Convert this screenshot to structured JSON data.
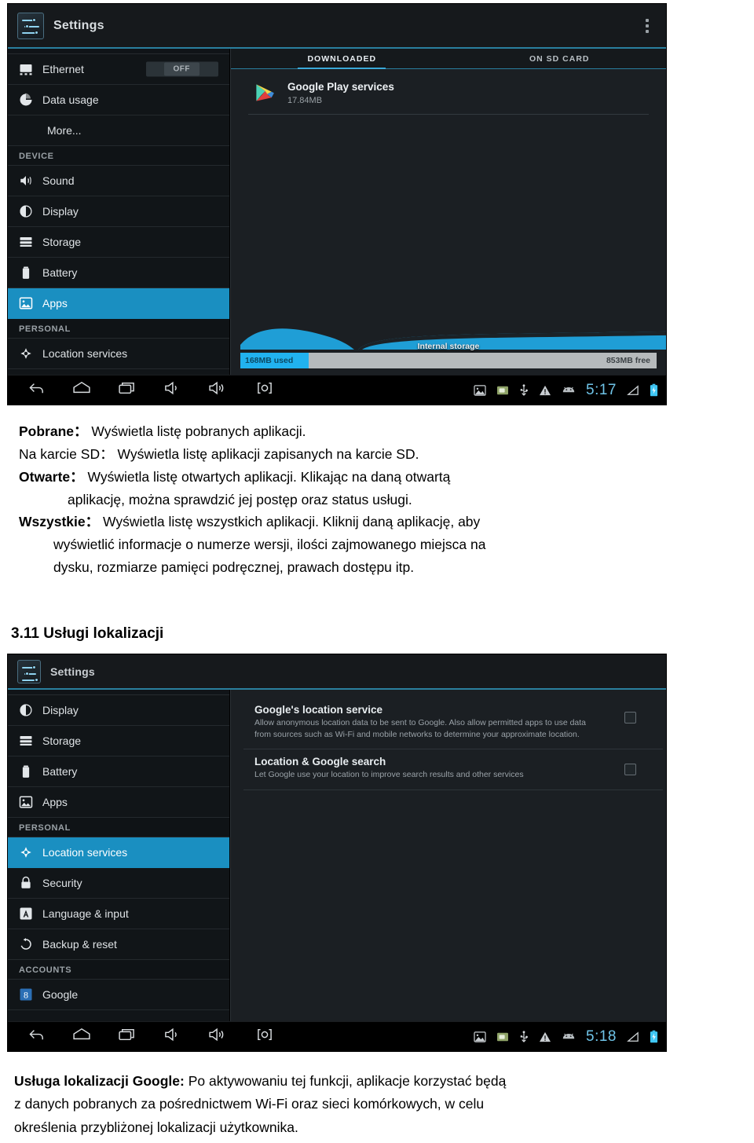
{
  "screenshot_apps": {
    "actionbar": {
      "title": "Settings",
      "overflow_icon": "overflow-menu-icon"
    },
    "sidebar": {
      "rows": [
        {
          "label": "Ethernet",
          "icon": "ethernet-icon",
          "toggle": "OFF",
          "selected": false,
          "indent": false
        },
        {
          "label": "Data usage",
          "icon": "data-usage-icon",
          "selected": false,
          "indent": false
        },
        {
          "label": "More...",
          "icon": "none",
          "selected": false,
          "indent": true
        },
        {
          "label": "DEVICE",
          "type": "header"
        },
        {
          "label": "Sound",
          "icon": "sound-icon",
          "selected": false,
          "indent": false
        },
        {
          "label": "Display",
          "icon": "display-icon",
          "selected": false,
          "indent": false
        },
        {
          "label": "Storage",
          "icon": "storage-icon",
          "selected": false,
          "indent": false
        },
        {
          "label": "Battery",
          "icon": "battery-icon",
          "selected": false,
          "indent": false
        },
        {
          "label": "Apps",
          "icon": "apps-icon",
          "selected": true,
          "indent": false
        },
        {
          "label": "PERSONAL",
          "type": "header"
        },
        {
          "label": "Location services",
          "icon": "location-icon",
          "selected": false,
          "indent": false
        }
      ]
    },
    "tabs": [
      {
        "label": "DOWNLOADED",
        "active": true
      },
      {
        "label": "ON SD CARD",
        "active": false
      }
    ],
    "apps": [
      {
        "name": "Google Play services",
        "size": "17.84MB",
        "icon": "play-services-icon"
      }
    ],
    "storage": {
      "label": "Internal storage",
      "used": "168MB used",
      "free": "853MB free",
      "used_percent": 16.5,
      "used_color": "#21b2ef",
      "free_color": "#b6babc"
    },
    "navbar": {
      "left_icons": [
        "back-icon",
        "home-icon",
        "recents-icon",
        "volume-down-icon",
        "volume-up-icon",
        "screenshot-icon"
      ],
      "status_icons": [
        "image-icon",
        "sd-card-icon",
        "usb-icon",
        "warning-icon",
        "android-icon"
      ],
      "clock": "5:17",
      "right_icons": [
        "signal-icon",
        "battery-charging-icon"
      ]
    }
  },
  "screenshot_location": {
    "actionbar": {
      "title": "Settings"
    },
    "sidebar": {
      "rows": [
        {
          "label": "Display",
          "icon": "display-icon",
          "selected": false
        },
        {
          "label": "Storage",
          "icon": "storage-icon",
          "selected": false
        },
        {
          "label": "Battery",
          "icon": "battery-icon",
          "selected": false
        },
        {
          "label": "Apps",
          "icon": "apps-icon",
          "selected": false
        },
        {
          "label": "PERSONAL",
          "type": "header"
        },
        {
          "label": "Location services",
          "icon": "location-icon",
          "selected": true
        },
        {
          "label": "Security",
          "icon": "lock-icon",
          "selected": false
        },
        {
          "label": "Language & input",
          "icon": "language-icon",
          "selected": false
        },
        {
          "label": "Backup & reset",
          "icon": "backup-reset-icon",
          "selected": false
        },
        {
          "label": "ACCOUNTS",
          "type": "header"
        },
        {
          "label": "Google",
          "icon": "google-icon",
          "selected": false
        }
      ]
    },
    "settings": [
      {
        "title": "Google's location service",
        "description": "Allow anonymous location data to be sent to Google. Also allow permitted apps to use data from sources such as Wi-Fi and mobile networks to determine your approximate location.",
        "checked": false
      },
      {
        "title": "Location & Google search",
        "description": "Let Google use your location to improve search results and other services",
        "checked": false
      }
    ],
    "navbar": {
      "clock": "5:18"
    }
  },
  "document": {
    "apps_section": [
      {
        "term": "Pobrane：",
        "text": " Wyświetla listę pobranych aplikacji.",
        "indent": 0
      },
      {
        "term": "Na karcie SD：",
        "text": "  Wyświetla listę aplikacji zapisanych na karcie SD.",
        "indent": 0
      },
      {
        "term": "Otwarte：",
        "text": " Wyświetla listę otwartych aplikacji. Klikając na daną otwartą",
        "indent": 0
      },
      {
        "term": "",
        "text": "aplikację, można sprawdzić jej postęp oraz status usługi.",
        "indent": 1
      },
      {
        "term": "Wszystkie：",
        "text": " Wyświetla listę wszystkich aplikacji. Kliknij daną aplikację, aby",
        "indent": 0
      },
      {
        "term": "",
        "text": "wyświetlić informacje o numerze wersji, ilości zajmowanego miejsca na",
        "indent": 2
      },
      {
        "term": "",
        "text": "dysku, rozmiarze pamięci podręcznej, prawach dostępu itp.",
        "indent": 2
      }
    ],
    "heading_311": "3.11 Usługi lokalizacji",
    "location_section": [
      {
        "term": "Usługa lokalizacji Google:",
        "text": " Po aktywowaniu tej funkcji, aplikacje korzystać będą"
      },
      {
        "term": "",
        "text": "z danych pobranych za pośrednictwem Wi-Fi oraz sieci komórkowych, w celu"
      },
      {
        "term": "",
        "text": "określenia przybliżonej lokalizacji użytkownika."
      }
    ]
  },
  "colors": {
    "accent_blue": "#1a8fc1",
    "tab_underline": "#3aa9d8",
    "clock_blue": "#6fc4e8",
    "panel_bg": "#1b1f23",
    "sidebar_bg": "#111518"
  }
}
